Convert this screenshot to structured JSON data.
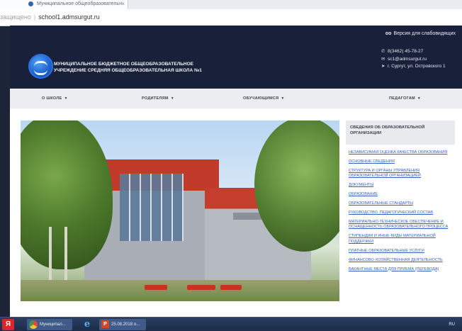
{
  "browser": {
    "tab_title": "Муниципальное общеобразовательн",
    "address_prefix": "защищено",
    "url": "school1.admsurgut.ru"
  },
  "header": {
    "low_vision_label": "Версия для слабовидящих",
    "school_name_line1": "МУНИЦИПАЛЬНОЕ БЮДЖЕТНОЕ ОБЩЕОБРАЗОВАТЕЛЬНОЕ",
    "school_name_line2": "УЧРЕЖДЕНИЕ СРЕДНЯЯ ОБЩЕОБРАЗОВАТЕЛЬНАЯ ШКОЛА №1",
    "phone": "8(3462) 45-78-27",
    "email": "sc1@admsurgut.ru",
    "address": "г. Сургут, ул. Островского 1"
  },
  "nav": {
    "items": [
      {
        "label": "О ШКОЛЕ"
      },
      {
        "label": "РОДИТЕЛЯМ"
      },
      {
        "label": "ОБУЧАЮЩИМСЯ"
      },
      {
        "label": "ПЕДАГОГАМ"
      }
    ]
  },
  "sidebar": {
    "title": "СВЕДЕНИЯ ОБ ОБРАЗОВАТЕЛЬНОЙ ОРГАНИЗАЦИИ",
    "links": [
      {
        "label": "НЕЗАВИСИМАЯ ОЦЕНКА КАЧЕСТВА ОБРАЗОВАНИЯ"
      },
      {
        "label": "ОСНОВНЫЕ СВЕДЕНИЯ"
      },
      {
        "label": "СТРУКТУРА И ОРГАНЫ УПРАВЛЕНИЯ ОБРАЗОВАТЕЛЬНОЙ ОРГАНИЗАЦИЕЙ"
      },
      {
        "label": "ДОКУМЕНТЫ"
      },
      {
        "label": "ОБРАЗОВАНИЕ"
      },
      {
        "label": "ОБРАЗОВАТЕЛЬНЫЕ СТАНДАРТЫ"
      },
      {
        "label": "РУКОВОДСТВО. ПЕДАГОГИЧЕСКИЙ СОСТАВ"
      },
      {
        "label": "МАТЕРИАЛЬНО-ТЕХНИЧЕСКОЕ ОБЕСПЕЧЕНИЕ И ОСНАЩЕННОСТЬ ОБРАЗОВАТЕЛЬНОГО ПРОЦЕССА"
      },
      {
        "label": "СТИПЕНДИИ И ИНЫЕ ВИДЫ МАТЕРИАЛЬНОЙ ПОДДЕРЖКИ"
      },
      {
        "label": "ПЛАТНЫЕ ОБРАЗОВАТЕЛЬНЫЕ УСЛУГИ"
      },
      {
        "label": "ФИНАНСОВО-ХОЗЯЙСТВЕННАЯ ДЕЯТЕЛЬНОСТЬ"
      },
      {
        "label": "ВАКАНТНЫЕ МЕСТА ДЛЯ ПРИЕМА (ПЕРЕВОДА)"
      }
    ]
  },
  "taskbar": {
    "start_label": "Я",
    "chrome_label": "Муниципал...",
    "ppt_label": "25.08.2018 о...",
    "ppt_icon_letter": "P",
    "ie_glyph": "e",
    "language": "RU"
  },
  "colors": {
    "header_bg": "#18203a",
    "link": "#3560c4",
    "nav_bg": "#ebedf0"
  }
}
